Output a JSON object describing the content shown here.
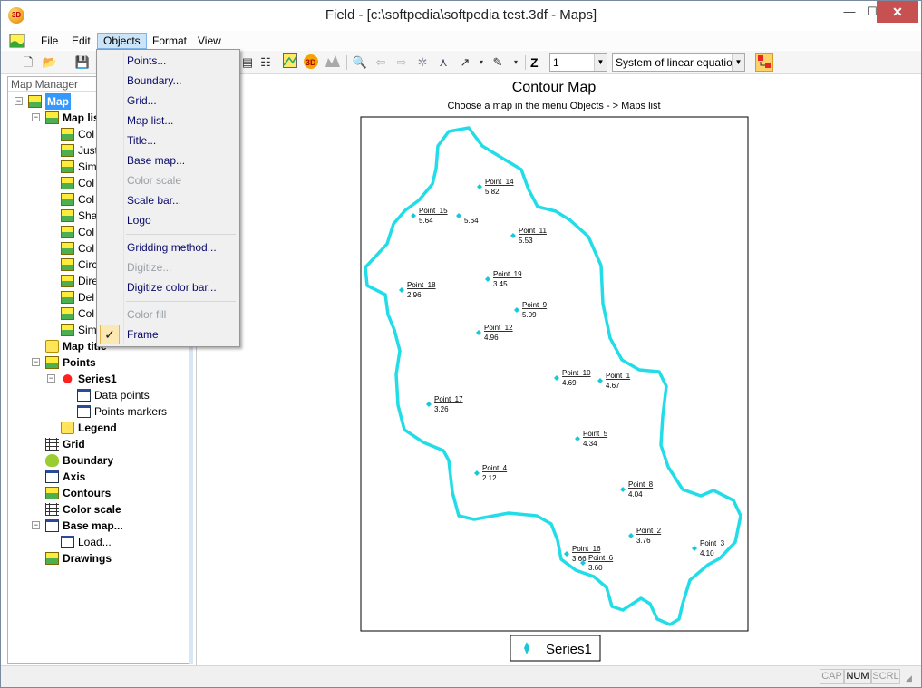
{
  "window": {
    "title": "Field - [c:\\softpedia\\softpedia test.3df - Maps]",
    "minimize": "—",
    "maximize": "☐",
    "close": "✕",
    "app_icon": "3D"
  },
  "menubar": {
    "items": [
      "File",
      "Edit",
      "Objects",
      "Format",
      "View"
    ],
    "active": "Objects"
  },
  "toolbar": {
    "z_label": "Z",
    "z_value": "1",
    "solver": "System of linear equatio"
  },
  "panel": {
    "title": "Map Manager"
  },
  "tree": [
    {
      "label": "Map",
      "level": 0,
      "icon": "map-icon",
      "bold": true,
      "selected": true,
      "expander": "−"
    },
    {
      "label": "Map list",
      "level": 1,
      "icon": "map-icon",
      "bold": true,
      "expander": "−"
    },
    {
      "label": "Col",
      "level": 2,
      "icon": "map-icon"
    },
    {
      "label": "Just",
      "level": 2,
      "icon": "map-icon"
    },
    {
      "label": "Sim",
      "level": 2,
      "icon": "map-icon"
    },
    {
      "label": "Col",
      "level": 2,
      "icon": "map-icon"
    },
    {
      "label": "Col",
      "level": 2,
      "icon": "map-icon"
    },
    {
      "label": "Sha",
      "level": 2,
      "icon": "map-icon"
    },
    {
      "label": "Col",
      "level": 2,
      "icon": "map-icon"
    },
    {
      "label": "Col",
      "level": 2,
      "icon": "map-icon"
    },
    {
      "label": "Circ",
      "level": 2,
      "icon": "map-icon"
    },
    {
      "label": "Dire",
      "level": 2,
      "icon": "map-icon"
    },
    {
      "label": "Del",
      "level": 2,
      "icon": "map-icon"
    },
    {
      "label": "Col",
      "level": 2,
      "icon": "map-icon"
    },
    {
      "label": "Sim",
      "level": 2,
      "icon": "map-icon"
    },
    {
      "label": "Map title",
      "level": 1,
      "icon": "folder-icon",
      "bold": true
    },
    {
      "label": "Points",
      "level": 1,
      "icon": "map-icon",
      "bold": true,
      "expander": "−"
    },
    {
      "label": "Series1",
      "level": 2,
      "icon": "red-dots-icon",
      "bold": true,
      "expander": "−"
    },
    {
      "label": "Data points",
      "level": 3,
      "icon": "document-icon"
    },
    {
      "label": "Points markers",
      "level": 3,
      "icon": "document-icon"
    },
    {
      "label": "Legend",
      "level": 2,
      "icon": "folder-icon",
      "bold": true
    },
    {
      "label": "Grid",
      "level": 1,
      "icon": "grid-icon",
      "bold": true
    },
    {
      "label": "Boundary",
      "level": 1,
      "icon": "boundary-icon",
      "bold": true
    },
    {
      "label": "Axis",
      "level": 1,
      "icon": "axis-icon",
      "bold": true
    },
    {
      "label": "Contours",
      "level": 1,
      "icon": "contours-icon",
      "bold": true
    },
    {
      "label": "Color scale",
      "level": 1,
      "icon": "color-scale-icon",
      "bold": true
    },
    {
      "label": "Base map...",
      "level": 1,
      "icon": "document-icon",
      "bold": true,
      "expander": "−"
    },
    {
      "label": "Load...",
      "level": 2,
      "icon": "document-icon"
    },
    {
      "label": "Drawings",
      "level": 1,
      "icon": "drawings-icon",
      "bold": true
    }
  ],
  "dropdown": [
    {
      "label": "Points...",
      "enabled": true
    },
    {
      "label": "Boundary...",
      "enabled": true
    },
    {
      "label": "Grid...",
      "enabled": true
    },
    {
      "label": "Map list...",
      "enabled": true
    },
    {
      "label": "Title...",
      "enabled": true
    },
    {
      "label": "Base map...",
      "enabled": true
    },
    {
      "label": "Color scale",
      "enabled": false
    },
    {
      "label": "Scale bar...",
      "enabled": true
    },
    {
      "label": "Logo",
      "enabled": true
    },
    {
      "separator": true
    },
    {
      "label": "Gridding method...",
      "enabled": true
    },
    {
      "label": "Digitize...",
      "enabled": false
    },
    {
      "label": "Digitize color bar...",
      "enabled": true
    },
    {
      "separator": true
    },
    {
      "label": "Color fill",
      "enabled": false
    },
    {
      "label": "Frame",
      "enabled": true,
      "checked": true
    }
  ],
  "map": {
    "title": "Contour Map",
    "subtitle": "Choose a map in the menu Objects - > Maps list",
    "legend": "Series1",
    "boundary_color": "#22dde8",
    "point_color": "#18c8d8"
  },
  "points": [
    {
      "name": "Point_14",
      "value": "5.82"
    },
    {
      "name": "Point_15",
      "value": "5.64"
    },
    {
      "name": "",
      "value": "5.64"
    },
    {
      "name": "Point_11",
      "value": "5.53"
    },
    {
      "name": "Point_18",
      "value": "2.96"
    },
    {
      "name": "Point_19",
      "value": "3.45"
    },
    {
      "name": "Point_9",
      "value": "5.09"
    },
    {
      "name": "Point_12",
      "value": "4.96"
    },
    {
      "name": "Point_10",
      "value": "4.69"
    },
    {
      "name": "Point_1",
      "value": "4.67"
    },
    {
      "name": "Point_17",
      "value": "3.26"
    },
    {
      "name": "Point_5",
      "value": "4.34"
    },
    {
      "name": "Point_4",
      "value": "2.12"
    },
    {
      "name": "Point_8",
      "value": "4.04"
    },
    {
      "name": "Point_2",
      "value": "3.76"
    },
    {
      "name": "Point_3",
      "value": "4.10"
    },
    {
      "name": "Point_16",
      "value": "3.66"
    },
    {
      "name": "Point_6",
      "value": "3.60"
    }
  ],
  "statusbar": {
    "cap": "CAP",
    "num": "NUM",
    "scrl": "SCRL"
  }
}
